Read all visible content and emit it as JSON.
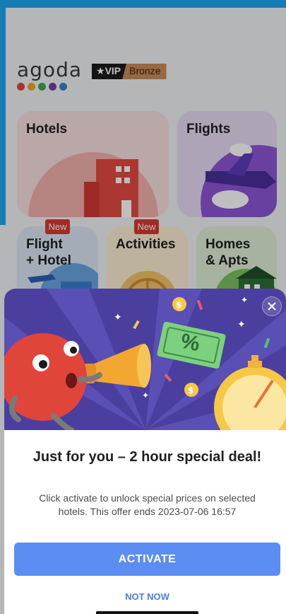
{
  "app": {
    "logo_text": "agoda",
    "logo_dot_colors": [
      "#e0453a",
      "#f2a627",
      "#3caa57",
      "#7d3aa8",
      "#2f86d1"
    ],
    "vip_label": "VIP",
    "vip_tier": "Bronze"
  },
  "tiles": {
    "hotels": "Hotels",
    "flights": "Flights",
    "flight_hotel_line1": "Flight",
    "flight_hotel_line2": "+ Hotel",
    "activities": "Activities",
    "homes_line1": "Homes",
    "homes_line2": "& Apts",
    "badge_new": "New"
  },
  "modal": {
    "title": "Just for you – 2 hour special deal!",
    "description": "Click activate to unlock special prices on selected hotels. This offer ends 2023-07-06 16:57",
    "activate_label": "ACTIVATE",
    "not_now_label": "NOT NOW",
    "coupon_text": "%"
  },
  "colors": {
    "accent_blue": "#5b8df2",
    "link_blue": "#4a7de8",
    "banner_bg": "#4a3f9f",
    "status_blue": "#1ea7f0"
  }
}
